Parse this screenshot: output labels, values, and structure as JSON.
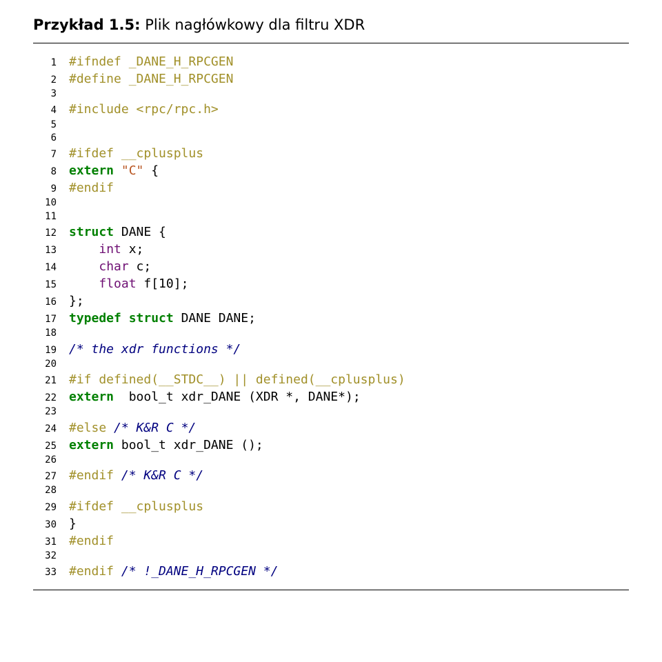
{
  "title_label": "Przykład 1.5:",
  "title_desc": "Plik nagłówkowy dla filtru XDR",
  "code": [
    [
      {
        "c": "pre",
        "t": "#ifndef _DANE_H_RPCGEN"
      }
    ],
    [
      {
        "c": "pre",
        "t": "#define _DANE_H_RPCGEN"
      }
    ],
    [],
    [
      {
        "c": "pre",
        "t": "#include <rpc/rpc.h>"
      }
    ],
    [],
    [],
    [
      {
        "c": "pre",
        "t": "#ifdef __cplusplus"
      }
    ],
    [
      {
        "c": "kw",
        "t": "extern"
      },
      {
        "c": "txt",
        "t": " "
      },
      {
        "c": "str",
        "t": "\"C\""
      },
      {
        "c": "txt",
        "t": " {"
      }
    ],
    [
      {
        "c": "pre",
        "t": "#endif"
      }
    ],
    [],
    [],
    [
      {
        "c": "kw",
        "t": "struct"
      },
      {
        "c": "txt",
        "t": " DANE {"
      }
    ],
    [
      {
        "c": "txt",
        "t": "    "
      },
      {
        "c": "type",
        "t": "int"
      },
      {
        "c": "txt",
        "t": " x;"
      }
    ],
    [
      {
        "c": "txt",
        "t": "    "
      },
      {
        "c": "type",
        "t": "char"
      },
      {
        "c": "txt",
        "t": " c;"
      }
    ],
    [
      {
        "c": "txt",
        "t": "    "
      },
      {
        "c": "type",
        "t": "float"
      },
      {
        "c": "txt",
        "t": " f[10];"
      }
    ],
    [
      {
        "c": "txt",
        "t": "};"
      }
    ],
    [
      {
        "c": "kw",
        "t": "typedef"
      },
      {
        "c": "txt",
        "t": " "
      },
      {
        "c": "kw",
        "t": "struct"
      },
      {
        "c": "txt",
        "t": " DANE DANE;"
      }
    ],
    [],
    [
      {
        "c": "cmt",
        "t": "/* the xdr functions */"
      }
    ],
    [],
    [
      {
        "c": "pre",
        "t": "#if defined(__STDC__) || defined(__cplusplus)"
      }
    ],
    [
      {
        "c": "kw",
        "t": "extern"
      },
      {
        "c": "txt",
        "t": "  bool_t xdr_DANE (XDR *, DANE*);"
      }
    ],
    [],
    [
      {
        "c": "pre",
        "t": "#else "
      },
      {
        "c": "cmt",
        "t": "/* K&R C */"
      }
    ],
    [
      {
        "c": "kw",
        "t": "extern"
      },
      {
        "c": "txt",
        "t": " bool_t xdr_DANE ();"
      }
    ],
    [],
    [
      {
        "c": "pre",
        "t": "#endif "
      },
      {
        "c": "cmt",
        "t": "/* K&R C */"
      }
    ],
    [],
    [
      {
        "c": "pre",
        "t": "#ifdef __cplusplus"
      }
    ],
    [
      {
        "c": "txt",
        "t": "}"
      }
    ],
    [
      {
        "c": "pre",
        "t": "#endif"
      }
    ],
    [],
    [
      {
        "c": "pre",
        "t": "#endif "
      },
      {
        "c": "cmt",
        "t": "/* !_DANE_H_RPCGEN */"
      }
    ]
  ]
}
